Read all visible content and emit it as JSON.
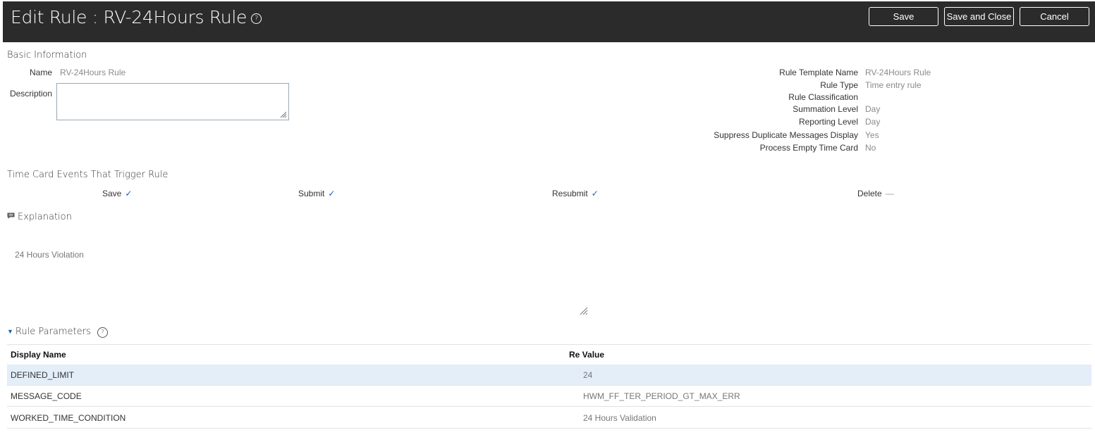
{
  "header": {
    "title": "Edit Rule : RV-24Hours Rule",
    "help_glyph": "?",
    "buttons": {
      "save": "Save",
      "save_close": "Save and Close",
      "cancel": "Cancel"
    }
  },
  "basic": {
    "section_title": "Basic Information",
    "name_label": "Name",
    "name_value": "RV-24Hours Rule",
    "description_label": "Description",
    "description_value": "",
    "fields": [
      {
        "label": "Rule Template Name",
        "value": "RV-24Hours Rule"
      },
      {
        "label": "Rule Type",
        "value": "Time entry rule"
      },
      {
        "label": "Rule Classification",
        "value": ""
      },
      {
        "label": "Summation Level",
        "value": "Day"
      },
      {
        "label": "Reporting Level",
        "value": "Day"
      },
      {
        "label": "Suppress Duplicate Messages Display",
        "value": "Yes"
      },
      {
        "label": "Process Empty Time Card",
        "value": "No"
      }
    ]
  },
  "events": {
    "section_title": "Time Card Events That Trigger Rule",
    "items": [
      {
        "label": "Save",
        "state": "✓"
      },
      {
        "label": "Submit",
        "state": "✓"
      },
      {
        "label": "Resubmit",
        "state": "✓"
      },
      {
        "label": "Delete",
        "state": "—"
      }
    ]
  },
  "explanation": {
    "section_title": "Explanation",
    "text": "24 Hours Violation"
  },
  "parameters": {
    "section_title": "Rule Parameters",
    "help_glyph": "?",
    "columns": [
      "Display Name",
      "Re Value"
    ],
    "rows": [
      {
        "name": "DEFINED_LIMIT",
        "value": "24"
      },
      {
        "name": "MESSAGE_CODE",
        "value": "HWM_FF_TER_PERIOD_GT_MAX_ERR"
      },
      {
        "name": "WORKED_TIME_CONDITION",
        "value": "24 Hours Validation"
      }
    ]
  },
  "colors": {
    "header_bg": "#2b2b2b",
    "accent": "#1a5fb4",
    "selected_row": "#e3eef9"
  }
}
